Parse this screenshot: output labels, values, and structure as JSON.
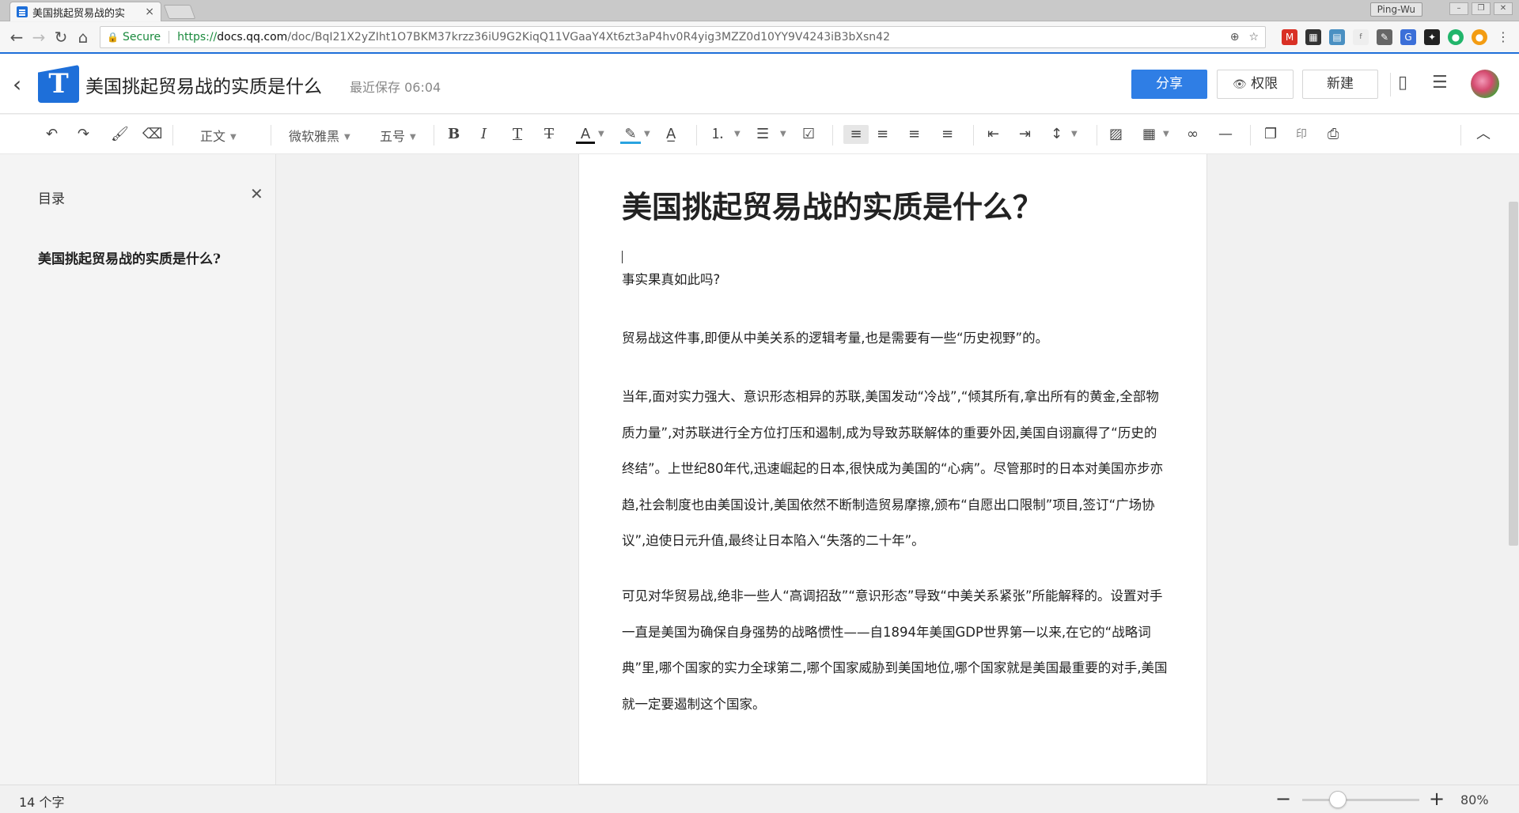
{
  "browser": {
    "tab_title": "美国挑起贸易战的实",
    "tab_close": "×",
    "profile": "Ping-Wu",
    "secure_label": "Secure",
    "url_scheme": "https://",
    "url_host": "docs.qq.com",
    "url_path": "/doc/BqI21X2yZIht1O7BKM37krzz36iU9G2KiqQ11VGaaY4Xt6zt3aP4hv0R4yig3MZZ0d10YY9V4243iB3bXsn42"
  },
  "header": {
    "back": "‹",
    "title": "美国挑起贸易战的实质是什么",
    "save_status": "最近保存 06:04",
    "share_label": "分享",
    "permission_label": "权限",
    "new_label": "新建"
  },
  "toolbar": {
    "style_select": "正文",
    "font_select": "微软雅黑",
    "size_select": "五号"
  },
  "sidebar": {
    "title": "目录",
    "items": [
      "美国挑起贸易战的实质是什么?"
    ]
  },
  "document": {
    "heading": "美国挑起贸易战的实质是什么？",
    "paragraphs": [
      "事实果真如此吗?",
      "贸易战这件事,即便从中美关系的逻辑考量,也是需要有一些“历史视野”的。",
      "当年,面对实力强大、意识形态相异的苏联,美国发动“冷战”,“倾其所有,拿出所有的黄金,全部物质力量”,对苏联进行全方位打压和遏制,成为导致苏联解体的重要外因,美国自诩赢得了“历史的终结”。上世纪80年代,迅速崛起的日本,很快成为美国的“心病”。尽管那时的日本对美国亦步亦趋,社会制度也由美国设计,美国依然不断制造贸易摩擦,颁布“自愿出口限制”项目,签订“广场协议”,迫使日元升值,最终让日本陷入“失落的二十年”。",
      "可见对华贸易战,绝非一些人“高调招敌”“意识形态”导致“中美关系紧张”所能解释的。设置对手一直是美国为确保自身强势的战略惯性——自1894年美国GDP世界第一以来,在它的“战略词典”里,哪个国家的实力全球第二,哪个国家威胁到美国地位,哪个国家就是美国最重要的对手,美国就一定要遏制这个国家。"
    ]
  },
  "statusbar": {
    "word_count": "14 个字",
    "zoom": "80%",
    "zoom_fraction": 0.25
  },
  "colors": {
    "accent": "#2f7ee5",
    "secure": "#1a8a3d"
  }
}
